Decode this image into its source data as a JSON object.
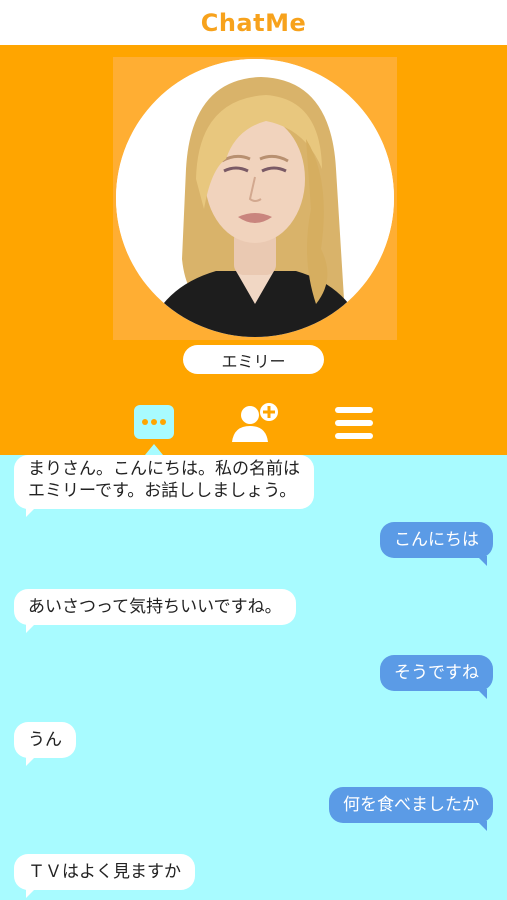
{
  "app": {
    "title": "ChatMe"
  },
  "profile": {
    "name": "エミリー"
  },
  "tabs": [
    {
      "icon": "chat-bubble-icon",
      "active": true
    },
    {
      "icon": "add-friend-icon",
      "active": false
    },
    {
      "icon": "menu-icon",
      "active": false
    }
  ],
  "messages": [
    {
      "from": "bot",
      "lines": [
        "まりさん。こんにちは。私の名前は",
        "エミリーです。お話ししましょう。"
      ]
    },
    {
      "from": "user",
      "text": "こんにちは"
    },
    {
      "from": "bot",
      "text": "あいさつって気持ちいいですね。"
    },
    {
      "from": "user",
      "text": "そうですね"
    },
    {
      "from": "bot",
      "text": "うん"
    },
    {
      "from": "user",
      "text": "何を食べましたか"
    },
    {
      "from": "bot",
      "text": "ＴＶはよく見ますか"
    }
  ],
  "colors": {
    "brand": "#F7A21C",
    "panel": "#FFA500",
    "chat_background": "#A8FBFF",
    "user_bubble": "#5B9BE6",
    "bot_bubble": "#FFFFFF"
  }
}
